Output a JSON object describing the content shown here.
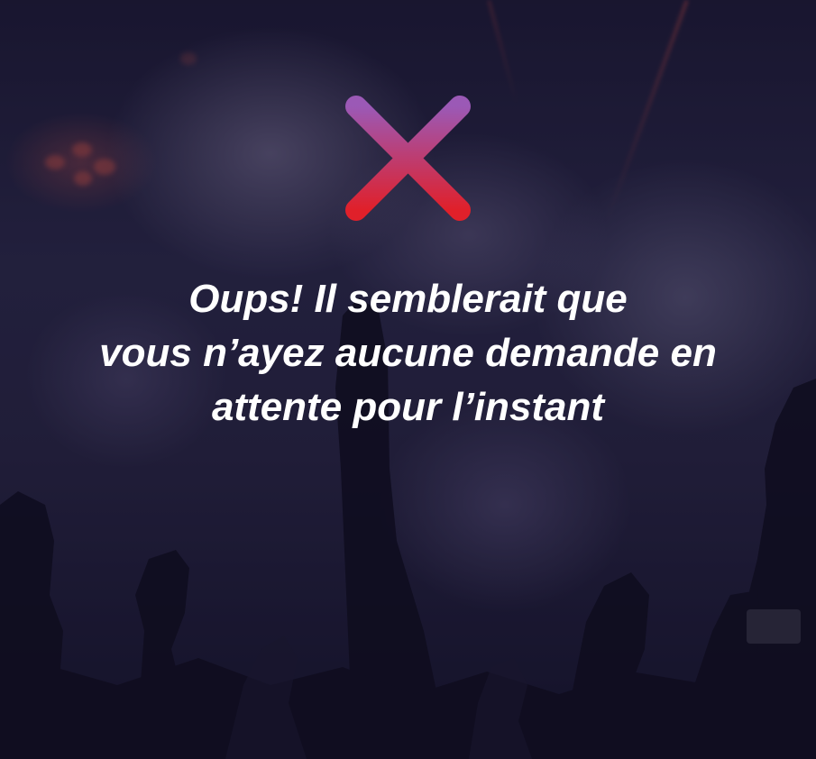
{
  "empty_state": {
    "icon": "close-icon",
    "icon_colors": {
      "top": "#9b59b6",
      "bottom": "#e0202a"
    },
    "message_lines": [
      "Oups! Il semblerait que",
      "vous n’ayez aucune demande en",
      "attente pour l’instant"
    ]
  },
  "background": {
    "description_icon": "concert-crowd-image"
  }
}
